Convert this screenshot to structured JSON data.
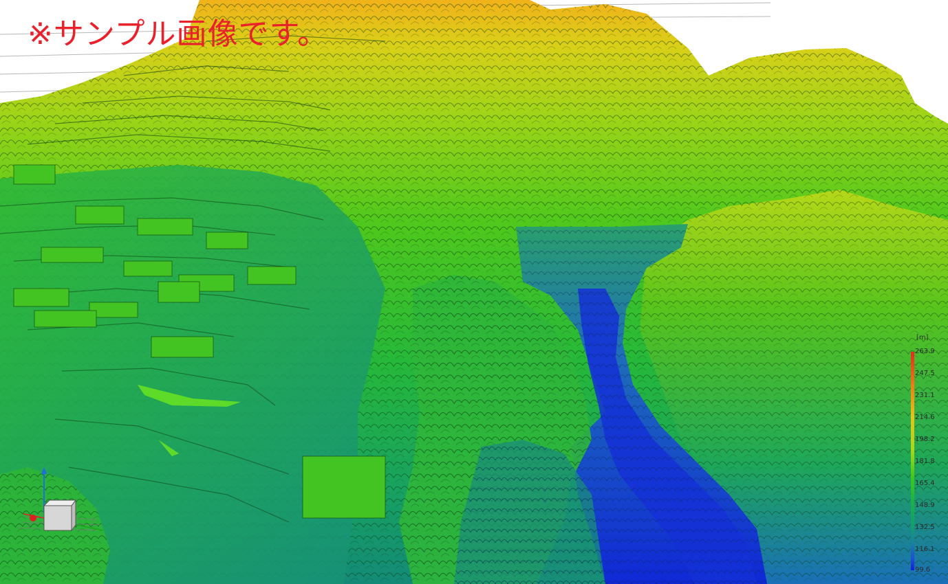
{
  "watermark": {
    "text": "※サンプル画像です。",
    "color": "#e8212b"
  },
  "color_scale": {
    "unit": "[m]",
    "max": "263.9",
    "min": "99.6",
    "ticks": [
      "263.9",
      "247.5",
      "231.1",
      "214.6",
      "198.2",
      "181.8",
      "165.4",
      "148.9",
      "132.5",
      "116.1",
      "99.6"
    ],
    "gradient_colors": [
      "#e32a1e",
      "#f07a14",
      "#e8c416",
      "#a8d818",
      "#3bc81c",
      "#19b04a",
      "#129f6e",
      "#1a7fa0",
      "#1c4ed6",
      "#1220d8"
    ]
  },
  "axis_gizmo": {
    "icon": "xyz-axis-gizmo-icon",
    "axis_colors": {
      "x": "#e02020",
      "y": "#1aa81a",
      "z": "#1f6fe0"
    }
  },
  "scene": {
    "description_icon": "point-cloud-elevation-map",
    "colors": {
      "sky": "#ffffff",
      "high": "#f0b418",
      "mid_high": "#c8dc16",
      "mid": "#3ec81e",
      "low_mid": "#18a86a",
      "low": "#1a5fd0",
      "river": "#1230d8"
    }
  }
}
